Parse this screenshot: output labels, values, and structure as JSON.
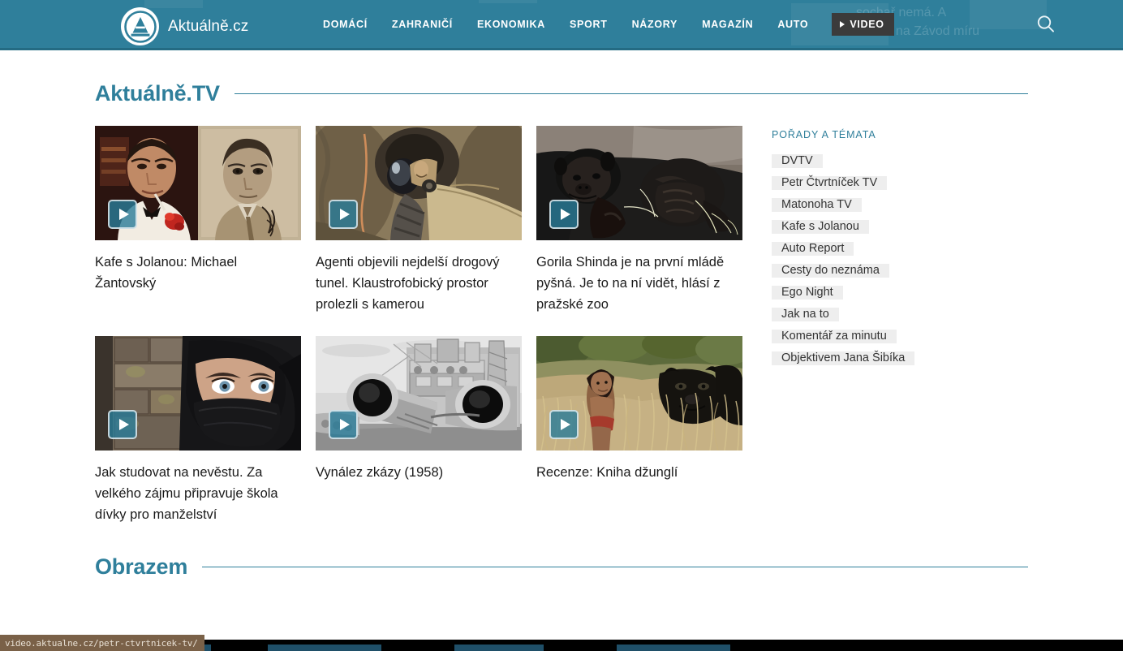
{
  "header": {
    "brand_name": "Aktuálně.cz",
    "logo_icon": "aktualne-a-logo",
    "nav_items": [
      {
        "label": "DOMÁCÍ",
        "name": "nav-domaci"
      },
      {
        "label": "ZAHRANIČÍ",
        "name": "nav-zahranici"
      },
      {
        "label": "EKONOMIKA",
        "name": "nav-ekonomika"
      },
      {
        "label": "SPORT",
        "name": "nav-sport"
      },
      {
        "label": "NÁZORY",
        "name": "nav-nazory"
      },
      {
        "label": "MAGAZÍN",
        "name": "nav-magazin"
      },
      {
        "label": "AUTO",
        "name": "nav-auto"
      }
    ],
    "video_label": "VIDEO",
    "search_icon": "search-icon",
    "ghost_text": "sochař nemá. A\nmentě na Závod míru",
    "bg_color": "#2f7f9b"
  },
  "sections": {
    "tv": {
      "title": "Aktuálně.TV",
      "sidebar_title": "POŘADY A TÉMATA",
      "tags": [
        "DVTV",
        "Petr Čtvrtníček TV",
        "Matonoha TV",
        "Kafe s Jolanou",
        "Auto Report",
        "Cesty do neznáma",
        "Ego Night",
        "Jak na to",
        "Komentář za minutu",
        "Objektivem Jana Šibíka"
      ],
      "cards": [
        {
          "title": "Kafe s Jolanou: Michael Žantovský",
          "art": "connery-kafka",
          "play_icon": "play-icon"
        },
        {
          "title": "Agenti objevili nejdelší drogový tunel. Klaustrofobický prostor prolezli s kamerou",
          "art": "tunnel",
          "play_icon": "play-icon"
        },
        {
          "title": "Gorila Shinda je na první mládě pyšná. Je to na ní vidět, hlásí z pražské zoo",
          "art": "gorilla",
          "play_icon": "play-icon"
        },
        {
          "title": "Jak studovat na nevěstu. Za velkého zájmu připravuje škola dívky pro manželství",
          "art": "veiled-woman",
          "play_icon": "play-icon"
        },
        {
          "title": "Vynález zkázy (1958)",
          "art": "battleship-guns",
          "play_icon": "play-icon"
        },
        {
          "title": "Recenze: Kniha džunglí",
          "art": "jungle-book",
          "play_icon": "play-icon"
        }
      ]
    },
    "obrazem": {
      "title": "Obrazem"
    }
  },
  "status_bar": {
    "url": "video.aktualne.cz/petr-ctvrtnicek-tv/"
  },
  "colors": {
    "brand_teal": "#2f7f9b",
    "header_border": "#246b83",
    "tag_bg": "#eeeeee",
    "video_btn_bg": "#3b3b3b"
  }
}
